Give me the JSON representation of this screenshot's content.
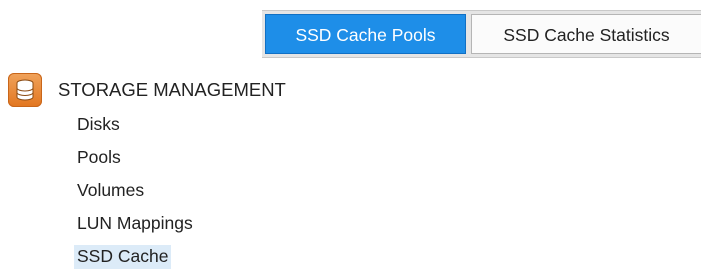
{
  "tabs": [
    {
      "label": "SSD Cache Pools",
      "active": true
    },
    {
      "label": "SSD Cache Statistics",
      "active": false
    }
  ],
  "section": {
    "icon": "storage-database-icon",
    "title": "STORAGE MANAGEMENT"
  },
  "menu": {
    "items": [
      {
        "label": "Disks"
      },
      {
        "label": "Pools"
      },
      {
        "label": "Volumes"
      },
      {
        "label": "LUN Mappings"
      },
      {
        "label": "SSD Cache",
        "selected": true
      }
    ]
  },
  "colors": {
    "accent": "#1e8ee8",
    "icon": "#e2761f",
    "selection": "#dcebf8"
  }
}
